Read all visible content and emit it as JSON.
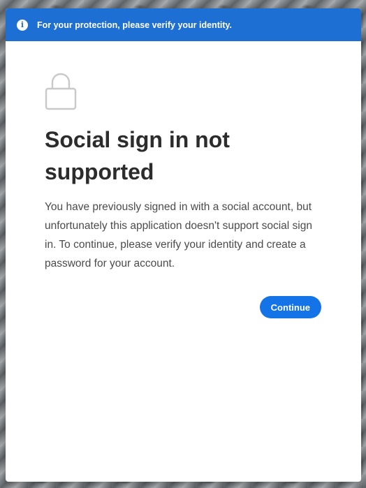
{
  "banner": {
    "icon": "info-icon",
    "text": "For your protection, please verify your identity."
  },
  "main": {
    "icon": "lock-icon",
    "title": "Social sign in not supported",
    "message": "You have previously signed in with a social account, but unfortunately this application doesn't support social sign in. To continue, please verify your identity and create a password for your account."
  },
  "actions": {
    "continue_label": "Continue"
  },
  "colors": {
    "banner": "#1e6fd4",
    "accent": "#1473e6",
    "title": "#2c2c2c",
    "body_text": "#4b4b4b"
  }
}
